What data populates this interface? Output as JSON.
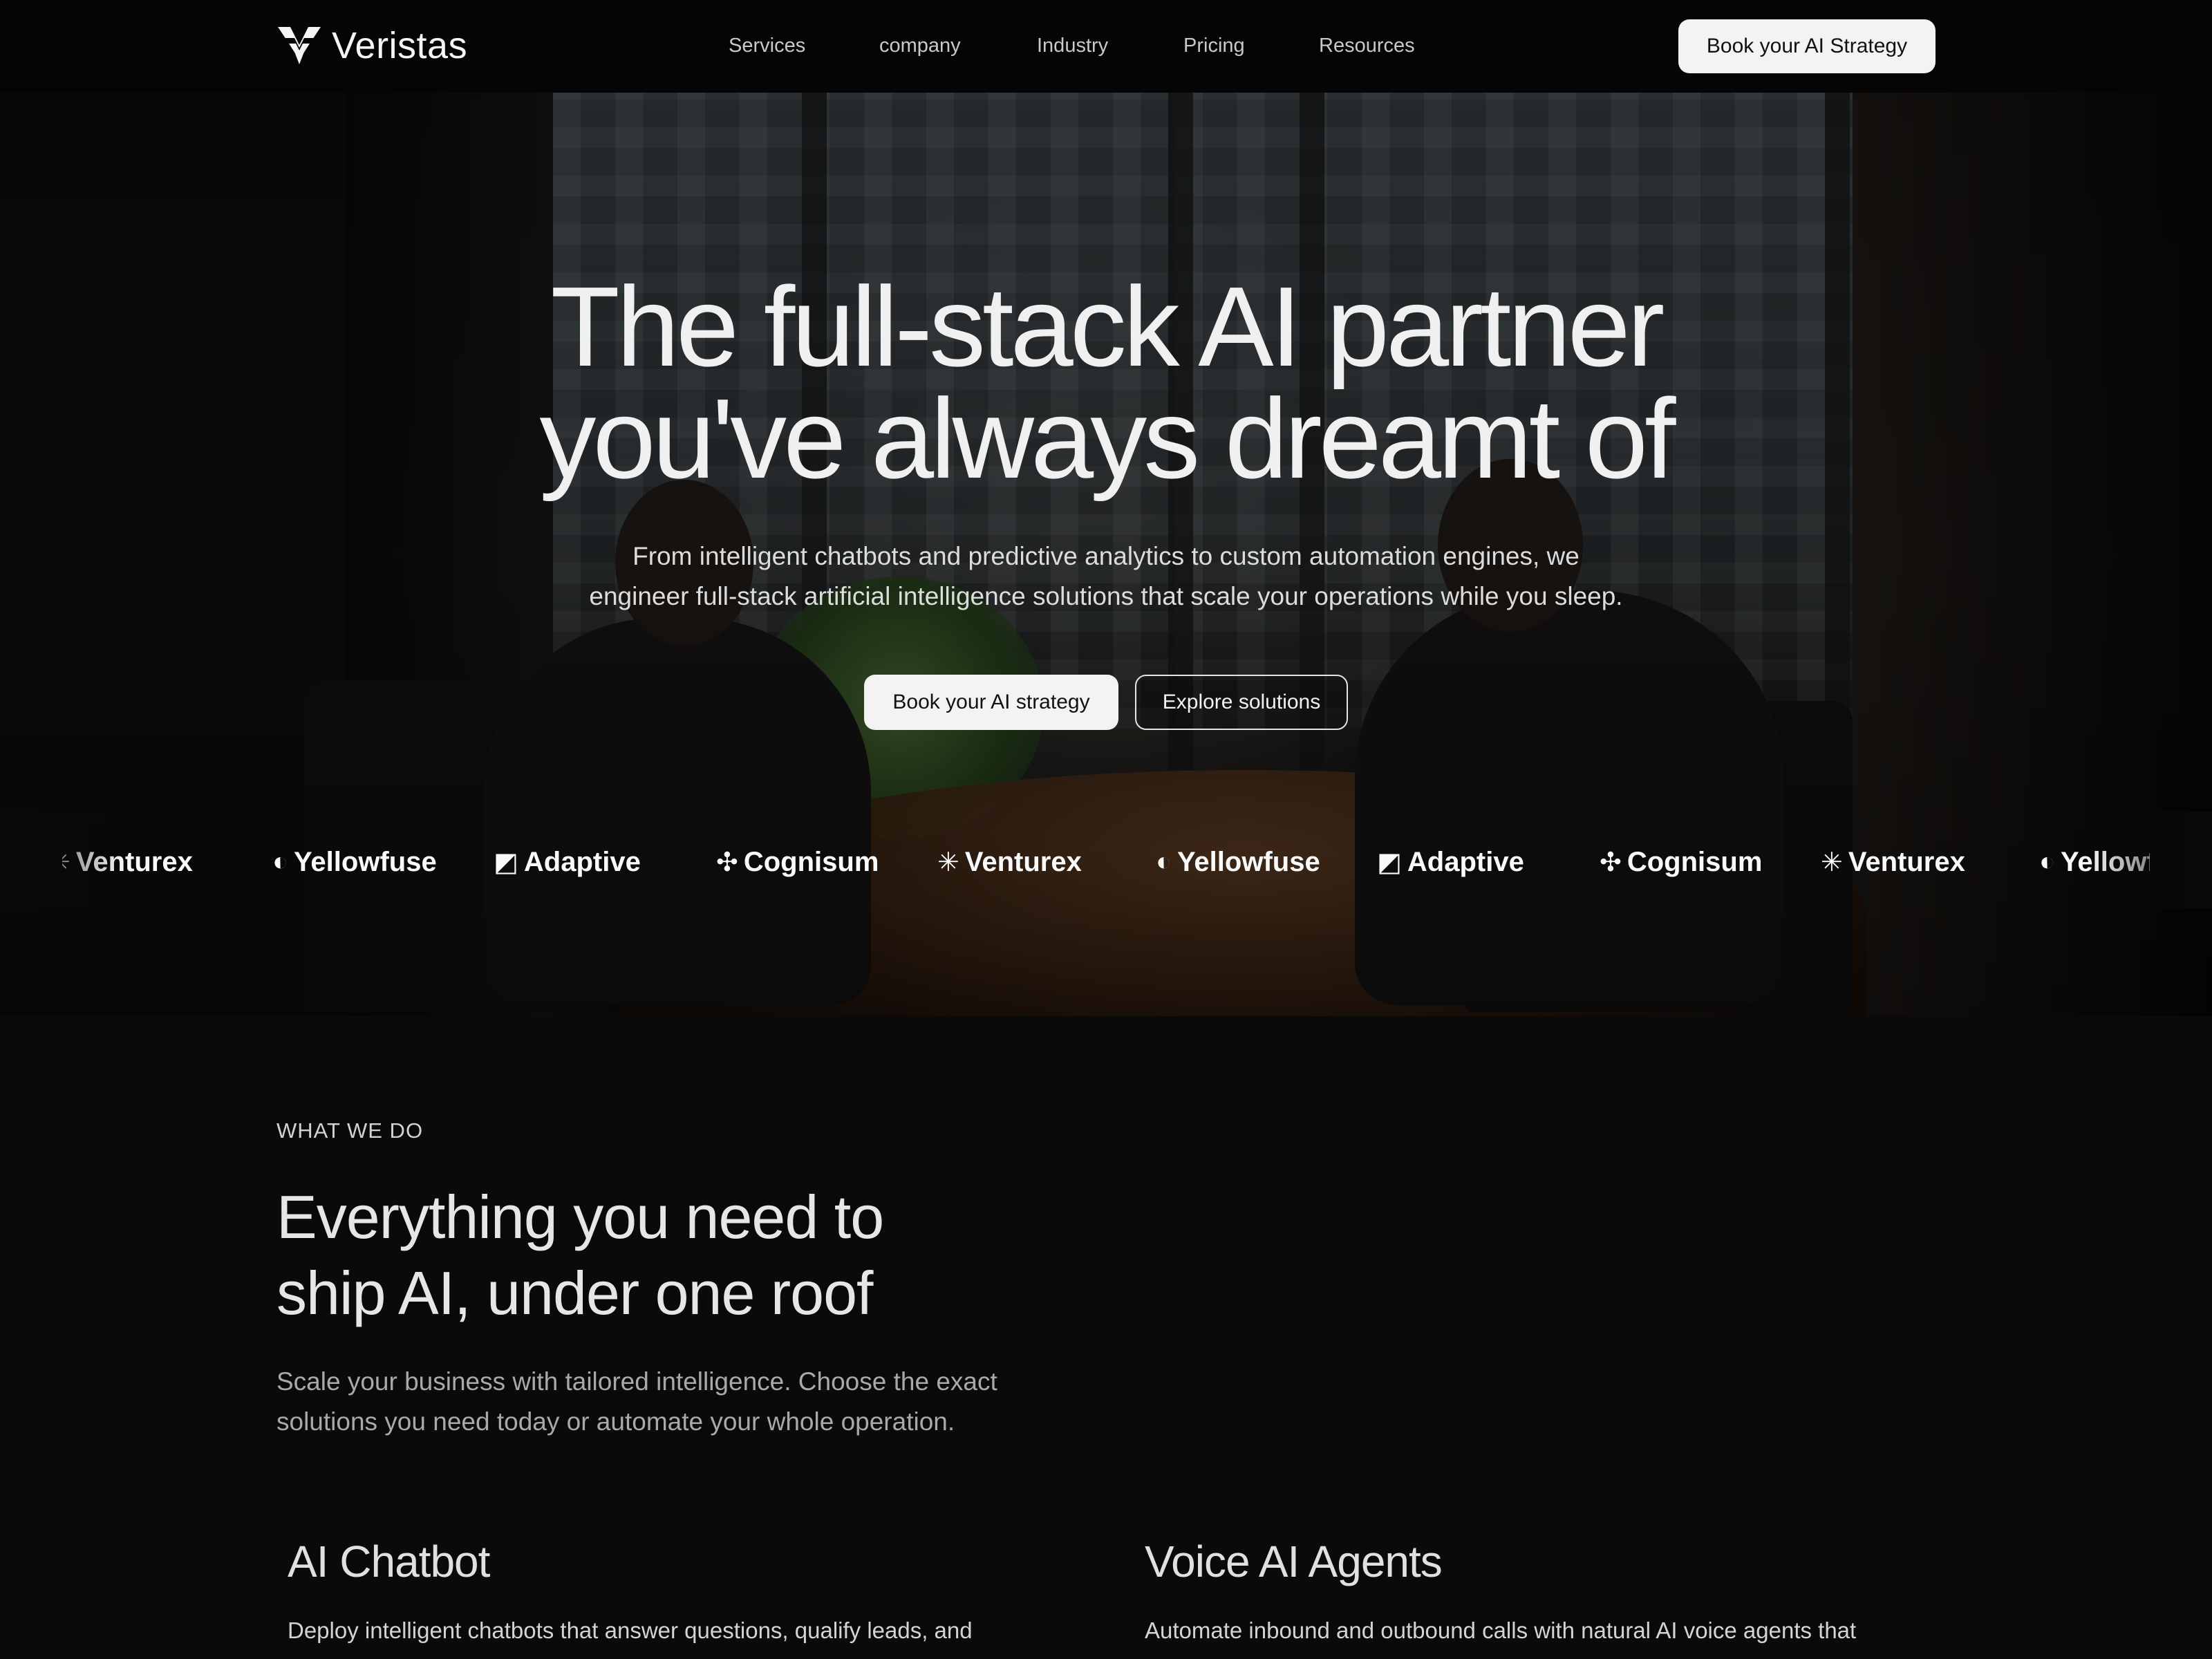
{
  "nav": {
    "brand": "Veristas",
    "links": [
      "Services",
      "company",
      "Industry",
      "Pricing",
      "Resources"
    ],
    "cta": "Book your AI Strategy"
  },
  "hero": {
    "title_line1": "The full-stack AI partner",
    "title_line2": "you've always dreamt of",
    "subtitle_line1": "From intelligent chatbots and predictive analytics to custom automation engines, we",
    "subtitle_line2": "engineer full-stack artificial intelligence solutions that scale your operations while you sleep.",
    "primary_button": "Book your AI strategy",
    "secondary_button": "Explore solutions"
  },
  "logo_strip": [
    {
      "name": "Venturex",
      "glyph": "✳",
      "icon": "venturex-logo-icon"
    },
    {
      "name": "Yellowfuse",
      "glyph": "◐",
      "icon": "yellowfuse-logo-icon"
    },
    {
      "name": "Adaptive",
      "glyph": "◩",
      "icon": "adaptive-logo-icon"
    },
    {
      "name": "Cognisum",
      "glyph": "✣",
      "icon": "cognisum-logo-icon"
    },
    {
      "name": "Venturex",
      "glyph": "✳",
      "icon": "venturex-logo-icon"
    },
    {
      "name": "Yellowfuse",
      "glyph": "◐",
      "icon": "yellowfuse-logo-icon"
    },
    {
      "name": "Adaptive",
      "glyph": "◩",
      "icon": "adaptive-logo-icon"
    },
    {
      "name": "Cognisum",
      "glyph": "✣",
      "icon": "cognisum-logo-icon"
    },
    {
      "name": "Venturex",
      "glyph": "✳",
      "icon": "venturex-logo-icon"
    },
    {
      "name": "Yellowfuse",
      "glyph": "◐",
      "icon": "yellowfuse-logo-icon"
    }
  ],
  "what_we_do": {
    "eyebrow": "WHAT WE DO",
    "title_line1": "Everything you need to",
    "title_line2": "ship AI, under one roof",
    "desc_line1": "Scale your business with tailored intelligence. Choose the exact",
    "desc_line2": "solutions you need today or automate your whole operation.",
    "cards": [
      {
        "title": "AI Chatbot",
        "desc": "Deploy intelligent chatbots that answer questions, qualify leads, and"
      },
      {
        "title": "Voice AI Agents",
        "desc": "Automate inbound and outbound calls with natural AI voice agents that"
      }
    ]
  },
  "colors": {
    "background": "#0a0a0a",
    "nav_background": "#050505",
    "button_light": "#f3f3f3",
    "text_primary": "#f0f0f0",
    "text_muted": "#a9a9a9"
  }
}
